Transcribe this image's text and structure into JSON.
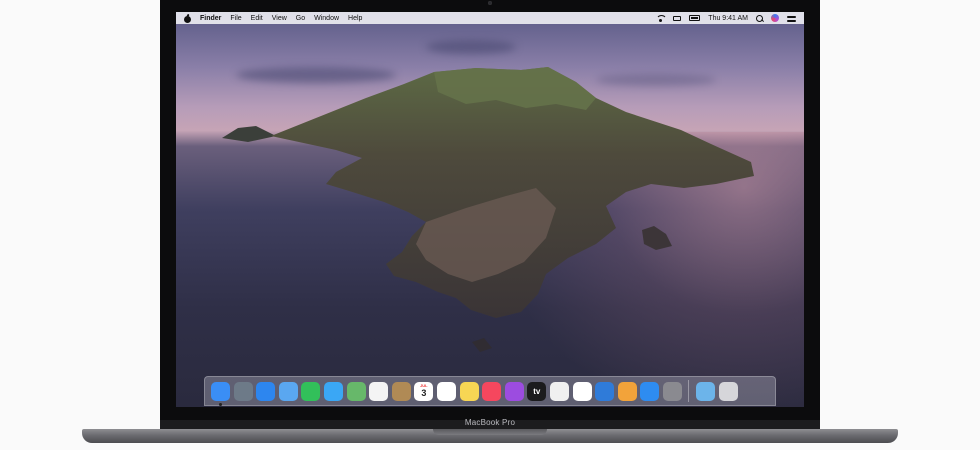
{
  "menubar": {
    "app_name": "Finder",
    "menus": [
      "File",
      "Edit",
      "View",
      "Go",
      "Window",
      "Help"
    ],
    "clock": "Thu 9:41 AM"
  },
  "status_icons": [
    "wifi-icon",
    "airplay-icon",
    "battery-icon",
    "search-icon",
    "siri-icon",
    "control-center-icon"
  ],
  "dock": {
    "apps": [
      {
        "name": "Finder",
        "icon": "finder-icon",
        "color": "#3a8ef5",
        "running": true
      },
      {
        "name": "Launchpad",
        "icon": "launchpad-icon",
        "color": "#6d7a88"
      },
      {
        "name": "Safari",
        "icon": "safari-icon",
        "color": "#2d86ef"
      },
      {
        "name": "Mail",
        "icon": "mail-icon",
        "color": "#5aa7f0"
      },
      {
        "name": "FaceTime",
        "icon": "facetime-icon",
        "color": "#32c05a"
      },
      {
        "name": "Messages",
        "icon": "messages-icon",
        "color": "#3aa7f5"
      },
      {
        "name": "Maps",
        "icon": "maps-icon",
        "color": "#67b86a"
      },
      {
        "name": "Photos",
        "icon": "photos-icon",
        "color": "#f4f4f4"
      },
      {
        "name": "Contacts",
        "icon": "contacts-icon",
        "color": "#b08a55"
      },
      {
        "name": "Calendar",
        "icon": "calendar-icon",
        "color": "#ffffff",
        "month": "JUL",
        "day": "3"
      },
      {
        "name": "Reminders",
        "icon": "reminders-icon",
        "color": "#ffffff"
      },
      {
        "name": "Notes",
        "icon": "notes-icon",
        "color": "#f7d654"
      },
      {
        "name": "Music",
        "icon": "music-icon",
        "color": "#f5475e"
      },
      {
        "name": "Podcasts",
        "icon": "podcasts-icon",
        "color": "#9c4ce0"
      },
      {
        "name": "TV",
        "icon": "tv-icon",
        "color": "#1b1b1d",
        "label": "tv"
      },
      {
        "name": "News",
        "icon": "news-icon",
        "color": "#f0f0f0"
      },
      {
        "name": "Numbers",
        "icon": "numbers-icon",
        "color": "#ffffff"
      },
      {
        "name": "Keynote",
        "icon": "keynote-icon",
        "color": "#2f7bd9"
      },
      {
        "name": "Pages",
        "icon": "pages-icon",
        "color": "#f2a33a"
      },
      {
        "name": "App Store",
        "icon": "app-store-icon",
        "color": "#2e8cf0"
      },
      {
        "name": "System Preferences",
        "icon": "system-preferences-icon",
        "color": "#8a8a90"
      }
    ],
    "extras": [
      {
        "name": "Downloads",
        "icon": "downloads-folder-icon",
        "color": "#6cb4ea"
      },
      {
        "name": "Trash",
        "icon": "trash-icon",
        "color": "#d6d6da"
      }
    ]
  },
  "device": {
    "model": "MacBook Pro"
  }
}
